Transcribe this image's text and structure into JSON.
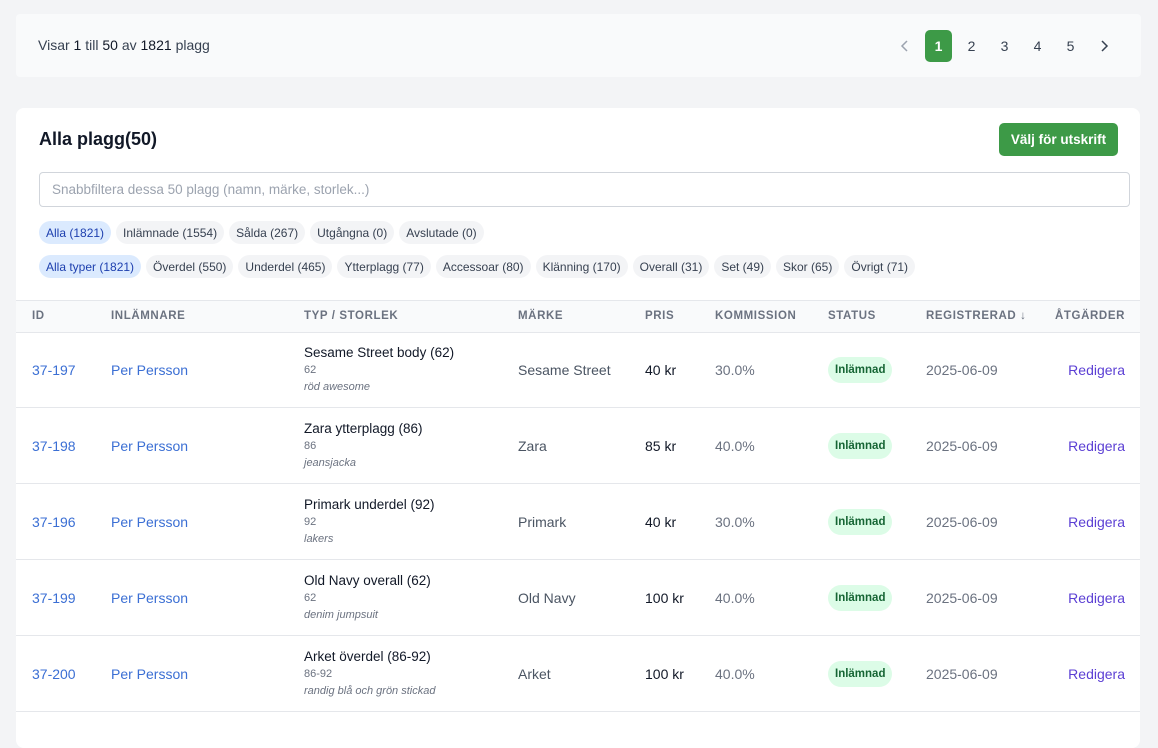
{
  "pager": {
    "info_prefix": "Visar",
    "from": "1",
    "mid1": "till",
    "to": "50",
    "mid2": "av",
    "total": "1821",
    "suffix": "plagg",
    "prev_icon": "chevron-left-icon",
    "next_icon": "chevron-right-icon",
    "pages": [
      "1",
      "2",
      "3",
      "4",
      "5"
    ],
    "active_page": "1"
  },
  "card": {
    "title": "Alla plagg(50)",
    "print_button": "Välj för utskrift",
    "search_placeholder": "Snabbfiltera dessa 50 plagg (namn, märke, storlek...)"
  },
  "status_filters": [
    {
      "label": "Alla (1821)",
      "active": true
    },
    {
      "label": "Inlämnade (1554)",
      "active": false
    },
    {
      "label": "Sålda (267)",
      "active": false
    },
    {
      "label": "Utgångna (0)",
      "active": false
    },
    {
      "label": "Avslutade (0)",
      "active": false
    }
  ],
  "type_filters": [
    {
      "label": "Alla typer (1821)",
      "active": true
    },
    {
      "label": "Överdel (550)",
      "active": false
    },
    {
      "label": "Underdel (465)",
      "active": false
    },
    {
      "label": "Ytterplagg (77)",
      "active": false
    },
    {
      "label": "Accessoar (80)",
      "active": false
    },
    {
      "label": "Klänning (170)",
      "active": false
    },
    {
      "label": "Overall (31)",
      "active": false
    },
    {
      "label": "Set (49)",
      "active": false
    },
    {
      "label": "Skor (65)",
      "active": false
    },
    {
      "label": "Övrigt (71)",
      "active": false
    }
  ],
  "columns": {
    "id": "ID",
    "submitter": "INLÄMNARE",
    "type": "TYP / STORLEK",
    "brand": "MÄRKE",
    "price": "PRIS",
    "commission": "KOMMISSION",
    "status": "STATUS",
    "registered": "REGISTRERAD ↓",
    "actions": "ÅTGÄRDER"
  },
  "rows": [
    {
      "id": "37-197",
      "submitter": "Per Persson",
      "title": "Sesame Street body (62)",
      "size": "62",
      "note": "röd awesome",
      "brand": "Sesame Street",
      "price": "40 kr",
      "commission": "30.0%",
      "status": "Inlämnad",
      "date": "2025-06-09",
      "action": "Redigera"
    },
    {
      "id": "37-198",
      "submitter": "Per Persson",
      "title": "Zara ytterplagg (86)",
      "size": "86",
      "note": "jeansjacka",
      "brand": "Zara",
      "price": "85 kr",
      "commission": "40.0%",
      "status": "Inlämnad",
      "date": "2025-06-09",
      "action": "Redigera"
    },
    {
      "id": "37-196",
      "submitter": "Per Persson",
      "title": "Primark underdel (92)",
      "size": "92",
      "note": "lakers",
      "brand": "Primark",
      "price": "40 kr",
      "commission": "30.0%",
      "status": "Inlämnad",
      "date": "2025-06-09",
      "action": "Redigera"
    },
    {
      "id": "37-199",
      "submitter": "Per Persson",
      "title": "Old Navy overall (62)",
      "size": "62",
      "note": "denim jumpsuit",
      "brand": "Old Navy",
      "price": "100 kr",
      "commission": "40.0%",
      "status": "Inlämnad",
      "date": "2025-06-09",
      "action": "Redigera"
    },
    {
      "id": "37-200",
      "submitter": "Per Persson",
      "title": "Arket överdel (86-92)",
      "size": "86-92",
      "note": "randig blå och grön stickad",
      "brand": "Arket",
      "price": "100 kr",
      "commission": "40.0%",
      "status": "Inlämnad",
      "date": "2025-06-09",
      "action": "Redigera"
    }
  ]
}
